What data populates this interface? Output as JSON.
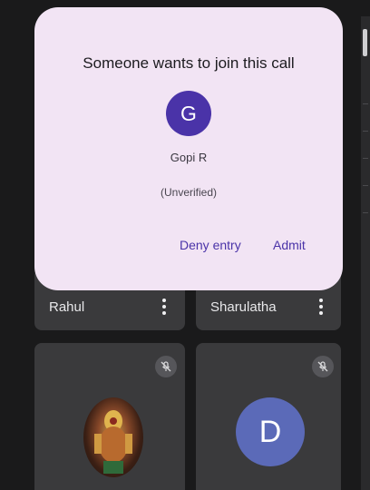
{
  "dialog": {
    "title": "Someone wants to join this call",
    "guest_initial": "G",
    "guest_name": "Gopi R",
    "guest_status": "(Unverified)",
    "deny_label": "Deny entry",
    "admit_label": "Admit"
  },
  "participants": [
    {
      "name": "Rahul"
    },
    {
      "name": "Sharulatha"
    }
  ],
  "tiles": [
    {
      "avatar": "photo",
      "muted": true
    },
    {
      "avatar": "D",
      "muted": true
    }
  ],
  "colors": {
    "dialog_bg": "#f2e4f4",
    "accent": "#4a33a8",
    "avatar_d": "#5b6ab8",
    "tile_bg": "#3a3a3c"
  }
}
